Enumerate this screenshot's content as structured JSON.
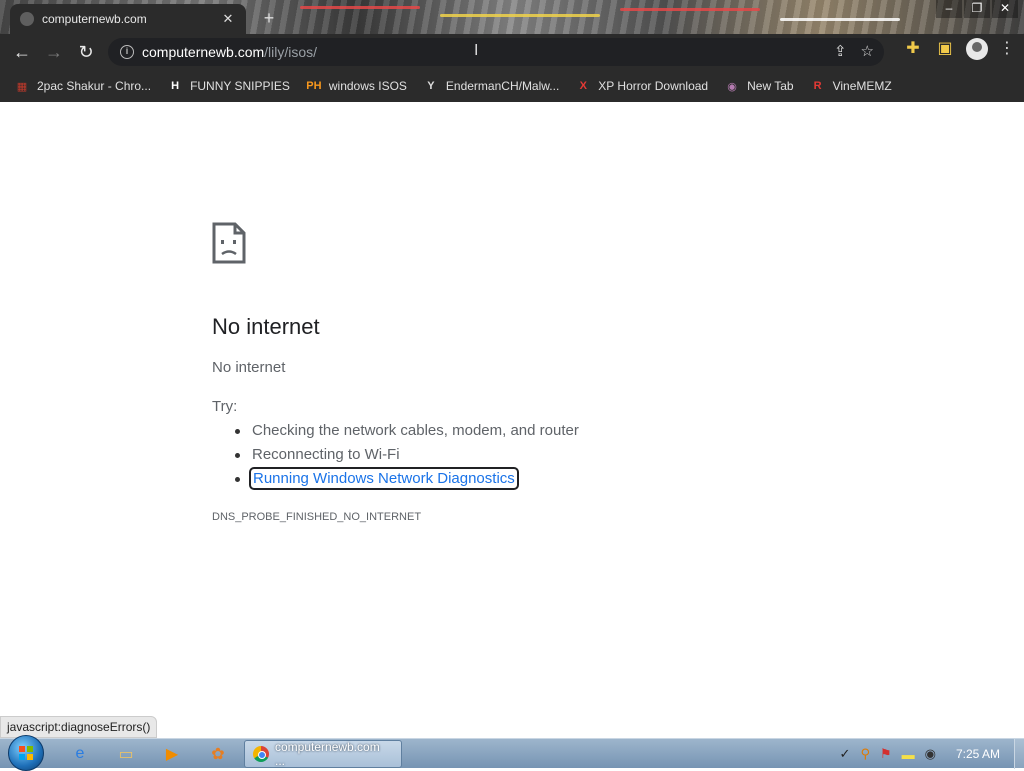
{
  "tab": {
    "title": "computernewb.com",
    "close_glyph": "✕",
    "new_tab_glyph": "+"
  },
  "window_controls": {
    "minimize": "–",
    "restore": "❐",
    "close": "✕"
  },
  "toolbar": {
    "back_glyph": "←",
    "forward_glyph": "→",
    "reload_glyph": "↻",
    "url_host": "computernewb.com",
    "url_path": "/lily/isos/",
    "share_glyph": "⇪",
    "star_glyph": "☆",
    "extensions_glyph": "✚",
    "sidepanel_glyph": "▣",
    "menu_glyph": "⋮"
  },
  "bookmarks": [
    {
      "label": "2pac Shakur - Chro...",
      "icon": "2pac-icon",
      "icon_glyph": "▦",
      "icon_color": "#c0392b"
    },
    {
      "label": "FUNNY SNIPPIES",
      "icon": "h-icon",
      "icon_glyph": "H",
      "icon_color": "#ffffff"
    },
    {
      "label": "windows ISOS",
      "icon": "ph-icon",
      "icon_glyph": "PH",
      "icon_color": "#f7971d"
    },
    {
      "label": "EndermanCH/Malw...",
      "icon": "yp-icon",
      "icon_glyph": "Y",
      "icon_color": "#dddddd"
    },
    {
      "label": "XP Horror Download",
      "icon": "x-icon",
      "icon_glyph": "X",
      "icon_color": "#e53935"
    },
    {
      "label": "New Tab",
      "icon": "globe-icon",
      "icon_glyph": "◉",
      "icon_color": "#b47bb0"
    },
    {
      "label": "VineMEMZ",
      "icon": "r-icon",
      "icon_glyph": "R",
      "icon_color": "#e53935"
    }
  ],
  "error": {
    "title": "No internet",
    "subtitle": "No internet",
    "try_label": "Try:",
    "suggestions": [
      "Checking the network cables, modem, and router",
      "Reconnecting to Wi-Fi",
      "Running Windows Network Diagnostics"
    ],
    "code": "DNS_PROBE_FINISHED_NO_INTERNET"
  },
  "status_bar": {
    "text": "javascript:diagnoseErrors()"
  },
  "taskbar": {
    "active_window_label": "computernewb.com ...",
    "pinned": [
      {
        "name": "ie-icon",
        "glyph": "e",
        "color": "#2a7de1"
      },
      {
        "name": "explorer-icon",
        "glyph": "▭",
        "color": "#e8c26a"
      },
      {
        "name": "media-player-icon",
        "glyph": "▶",
        "color": "#f08c00"
      },
      {
        "name": "paint-icon",
        "glyph": "✿",
        "color": "#e67e22"
      }
    ],
    "clock": "7:25 AM"
  }
}
